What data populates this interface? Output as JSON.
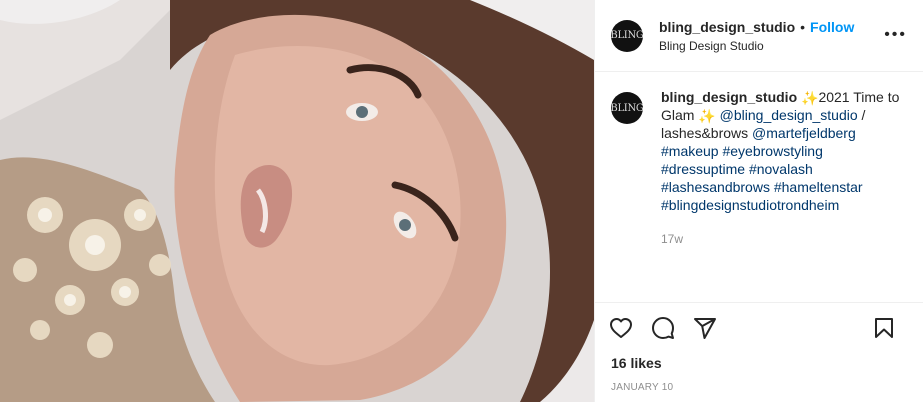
{
  "post": {
    "image_alt_icon": "portrait-photo",
    "header": {
      "username": "bling_design_studio",
      "dot": "•",
      "follow_label": "Follow",
      "subtitle": "Bling Design Studio",
      "avatar_text": "BLING",
      "more_label": "•••"
    },
    "caption": {
      "username": "bling_design_studio",
      "text_1": "2021 Time to Glam",
      "emoji": "✨",
      "mention_1": "@bling_design_studio",
      "text_2": "/ lashes&brows",
      "mention_2": "@martefjeldberg",
      "hashtags": [
        "#makeup",
        "#eyebrowstyling",
        "#dressuptime",
        "#novalash",
        "#lashesandbrows",
        "#hameltenstar",
        "#blingdesignstudiotrondheim"
      ],
      "age": "17w"
    },
    "actions": {
      "like_icon": "heart-icon",
      "comment_icon": "comment-icon",
      "share_icon": "share-icon",
      "save_icon": "bookmark-icon"
    },
    "likes": "16 likes",
    "date": "JANUARY 10"
  },
  "colors": {
    "follow": "#0095f6",
    "link": "#00376b",
    "muted": "#8e8e8e",
    "text": "#262626"
  }
}
